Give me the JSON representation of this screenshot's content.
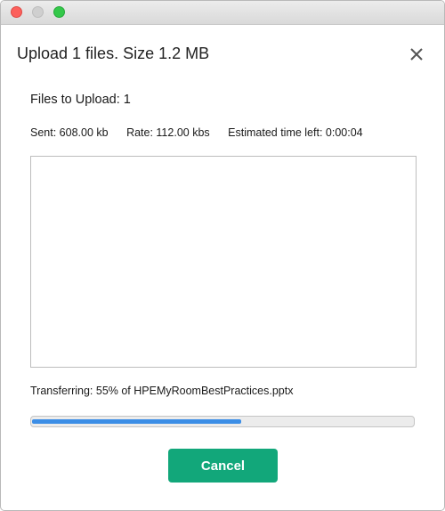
{
  "window": {
    "controls": [
      "close",
      "minimize",
      "zoom"
    ]
  },
  "dialog": {
    "title": "Upload 1 files. Size 1.2 MB",
    "close_icon": "close-x-icon"
  },
  "upload": {
    "files_to_upload": "Files to Upload: 1",
    "sent": "Sent: 608.00 kb",
    "rate": "Rate: 112.00 kbs",
    "time_left": "Estimated time left: 0:00:04",
    "file_list": [],
    "transfer_status": "Transferring: 55% of HPEMyRoomBestPractices.pptx",
    "progress_fraction": 0.55
  },
  "actions": {
    "cancel_label": "Cancel"
  },
  "colors": {
    "accent": "#12a77a",
    "progress": "#3c8ee6"
  }
}
